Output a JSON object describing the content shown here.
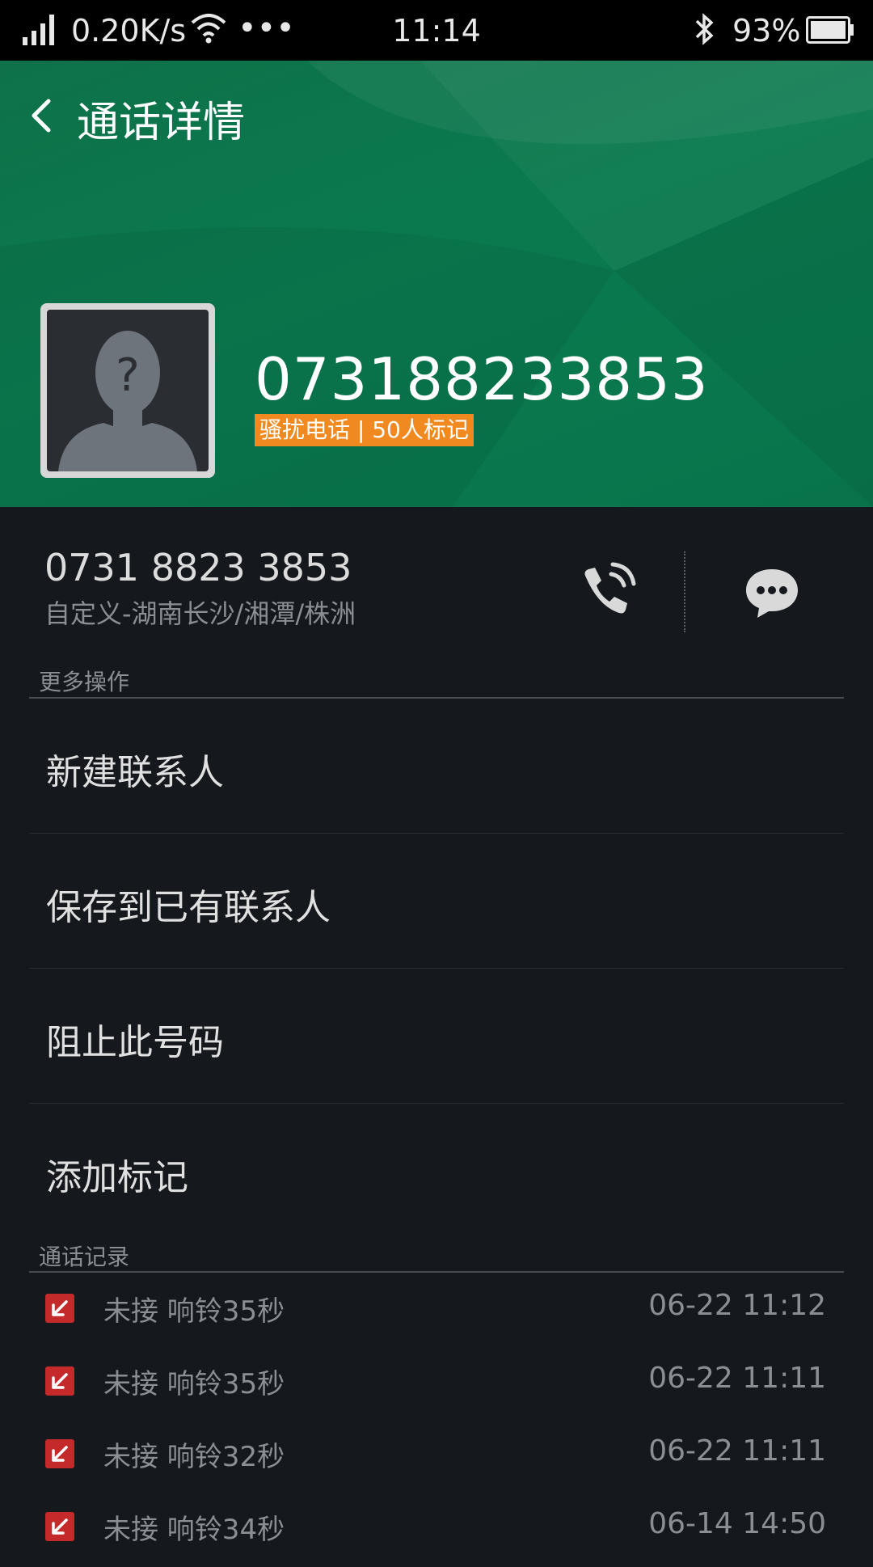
{
  "status_bar": {
    "speed": "0.20K/s",
    "dots": "•••",
    "time": "11:14",
    "battery": "93%"
  },
  "header": {
    "title": "通话详情",
    "number": "073188233853",
    "tag": "骚扰电话 | 50人标记",
    "avatar_mark": "?"
  },
  "contact": {
    "formatted_number": "0731 8823 3853",
    "location": "自定义-湖南长沙/湘潭/株洲"
  },
  "more_actions": {
    "heading": "更多操作",
    "items": [
      "新建联系人",
      "保存到已有联系人",
      "阻止此号码",
      "添加标记"
    ]
  },
  "call_log": {
    "heading": "通话记录",
    "entries": [
      {
        "desc": "未接 响铃35秒",
        "time": "06-22 11:12"
      },
      {
        "desc": "未接 响铃35秒",
        "time": "06-22 11:11"
      },
      {
        "desc": "未接 响铃32秒",
        "time": "06-22 11:11"
      },
      {
        "desc": "未接 响铃34秒",
        "time": "06-14 14:50"
      }
    ]
  },
  "colors": {
    "header_green": "#0a7a4e",
    "tag_orange": "#f0891f",
    "missed_red": "#c52a2a",
    "background": "#15181c"
  }
}
